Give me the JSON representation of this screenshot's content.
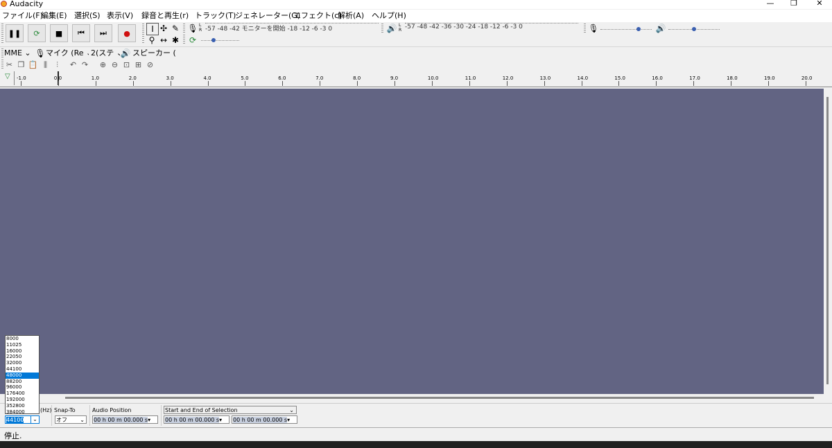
{
  "window": {
    "title": "Audacity"
  },
  "menu": [
    "ファイル(F)",
    "編集(E)",
    "選択(S)",
    "表示(V)",
    "録音と再生(r)",
    "トラック(T)",
    "ジェネレーター(G)",
    "エフェクト(c)",
    "解析(A)",
    "ヘルプ(H)"
  ],
  "record_meter": {
    "scale": "-57   -48   -42  モニターを開始  -18   -12   -6  -3  0",
    "lr": "L\nR"
  },
  "play_meter": {
    "scale": "-57       -48   -42   -36   -30   -24   -18   -12   -6  -3  0",
    "lr": "L\nR"
  },
  "device": {
    "host": "MME",
    "input": "マイク (Re",
    "channels": "2(ステ",
    "output": "スピーカー ("
  },
  "ruler": [
    "-1.0",
    "0.0",
    "1.0",
    "2.0",
    "3.0",
    "4.0",
    "5.0",
    "6.0",
    "7.0",
    "8.0",
    "9.0",
    "10.0",
    "11.0",
    "12.0",
    "13.0",
    "14.0",
    "15.0",
    "16.0",
    "17.0",
    "18.0",
    "19.0",
    "20.0"
  ],
  "selection_bar": {
    "rate_unit": "(Hz)",
    "rate_value": "44100",
    "snap_label": "Snap-To",
    "snap_value": "オフ",
    "audio_position_label": "Audio Position",
    "selection_mode": "Start and End of Selection",
    "time_audio": "00 h 00 m 00.000 s",
    "time_start": "00 h 00 m 00.000 s",
    "time_end": "00 h 00 m 00.000 s"
  },
  "rate_options": [
    "8000",
    "11025",
    "16000",
    "22050",
    "32000",
    "44100",
    "48000",
    "88200",
    "96000",
    "176400",
    "192000",
    "352800",
    "384000"
  ],
  "rate_selected_index": 6,
  "status": {
    "text": "停止."
  }
}
